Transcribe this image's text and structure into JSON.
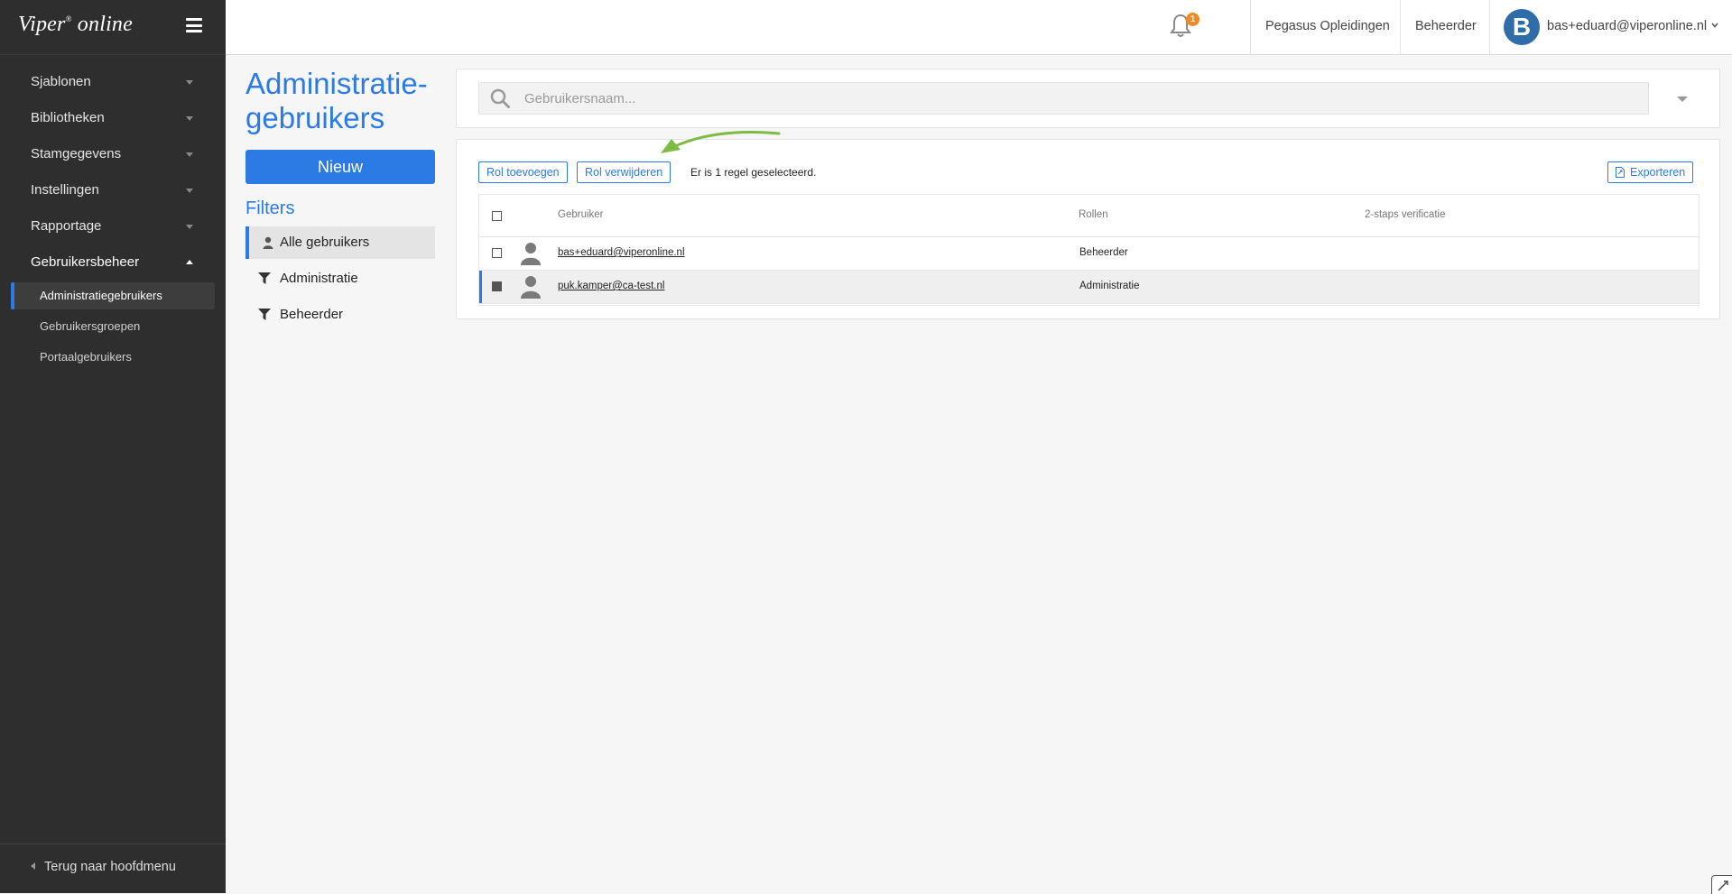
{
  "app": {
    "logo_main": "Viper",
    "logo_mark": "®",
    "logo_sub": "online"
  },
  "sidebar": {
    "items": [
      {
        "label": "Sjablonen"
      },
      {
        "label": "Bibliotheken"
      },
      {
        "label": "Stamgegevens"
      },
      {
        "label": "Instellingen"
      },
      {
        "label": "Rapportage"
      },
      {
        "label": "Gebruikersbeheer"
      }
    ],
    "subitems": [
      {
        "label": "Administratiegebruikers",
        "active": true
      },
      {
        "label": "Gebruikersgroepen"
      },
      {
        "label": "Portaalgebruikers"
      }
    ],
    "back_label": "Terug naar hoofdmenu"
  },
  "topbar": {
    "notification_count": "1",
    "organization": "Pegasus Opleidingen",
    "role": "Beheerder",
    "avatar_letter": "B",
    "user_email": "bas+eduard@viperonline.nl"
  },
  "page": {
    "title": "Administratie-gebruikers",
    "new_button": "Nieuw",
    "filters_title": "Filters",
    "filters": [
      {
        "label": "Alle gebruikers",
        "icon": "person-icon",
        "active": true
      },
      {
        "label": "Administratie",
        "icon": "funnel-icon"
      },
      {
        "label": "Beheerder",
        "icon": "funnel-icon"
      }
    ]
  },
  "search": {
    "placeholder": "Gebruikersnaam..."
  },
  "toolbar": {
    "add_role": "Rol toevoegen",
    "remove_role": "Rol verwijderen",
    "selection_info": "Er is 1 regel geselecteerd.",
    "export": "Exporteren"
  },
  "table": {
    "columns": [
      "Gebruiker",
      "Rollen",
      "2-staps verificatie"
    ],
    "rows": [
      {
        "user": "bas+eduard@viperonline.nl",
        "role": "Beheerder",
        "two_factor": "",
        "selected": false
      },
      {
        "user": "puk.kamper@ca-test.nl",
        "role": "Administratie",
        "two_factor": "",
        "selected": true
      }
    ]
  },
  "colors": {
    "accent": "#2c7be5",
    "sidebar_bg": "#2e2e2e",
    "badge": "#f08a24",
    "annotation_arrow": "#7dbb42"
  }
}
